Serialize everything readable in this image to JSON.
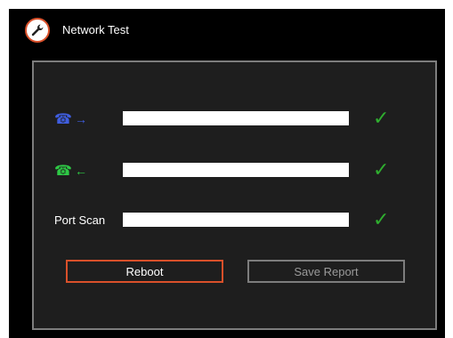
{
  "app": {
    "title": "Network Test",
    "icon": "wrench-icon"
  },
  "tests": [
    {
      "label": "",
      "icon": "phone-icon",
      "arrow": "→",
      "arrow_color": "#3f5ee0",
      "progress": 1.0,
      "status": "✓"
    },
    {
      "label": "",
      "icon": "phone-icon",
      "arrow": "←",
      "arrow_color": "#2ec845",
      "progress": 1.0,
      "status": "✓"
    },
    {
      "label": "Port Scan",
      "progress": 1.0,
      "status": "✓"
    }
  ],
  "buttons": {
    "reboot_label": "Reboot",
    "save_report_label": "Save Report"
  },
  "colors": {
    "accent": "#d9502a",
    "check": "#2fae2f",
    "panel_border": "#7d7d7d",
    "disabled_text": "#9a9a9a"
  }
}
